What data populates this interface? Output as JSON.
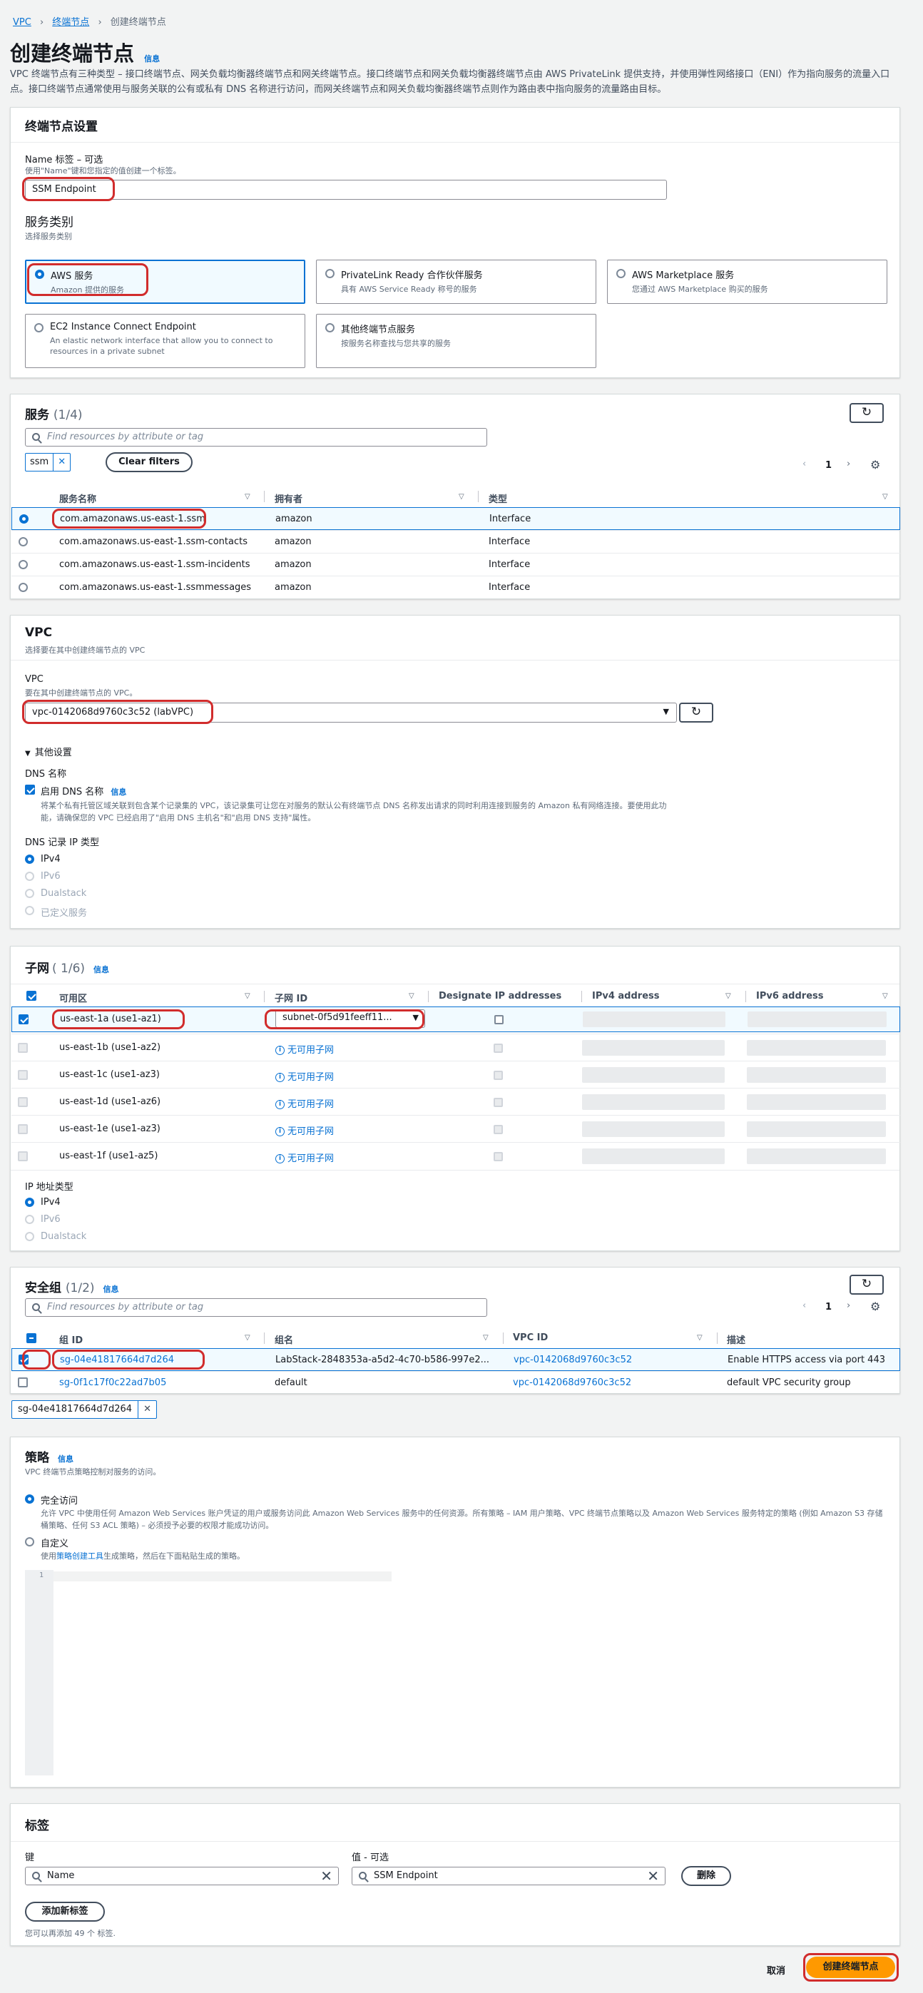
{
  "breadcrumb": {
    "items": [
      "VPC",
      "终端节点",
      "创建终端节点"
    ]
  },
  "page": {
    "title": "创建终端节点",
    "info": "信息",
    "description": "VPC 终端节点有三种类型 – 接口终端节点、网关负载均衡器终端节点和网关终端节点。接口终端节点和网关负载均衡器终端节点由 AWS PrivateLink 提供支持，并使用弹性网络接口（ENI）作为指向服务的流量入口点。接口终端节点通常使用与服务关联的公有或私有 DNS 名称进行访问，而网关终端节点和网关负载均衡器终端节点则作为路由表中指向服务的流量路由目标。"
  },
  "settings": {
    "title": "终端节点设置",
    "name_label": "Name 标签 – 可选",
    "name_hint": "使用\"Name\"键和您指定的值创建一个标签。",
    "name_value": "SSM Endpoint",
    "category_label": "服务类别",
    "category_hint": "选择服务类别",
    "tiles": [
      {
        "title": "AWS 服务",
        "desc": "Amazon 提供的服务"
      },
      {
        "title": "PrivateLink Ready 合作伙伴服务",
        "desc": "具有 AWS Service Ready 称号的服务"
      },
      {
        "title": "AWS Marketplace 服务",
        "desc": "您通过 AWS Marketplace 购买的服务"
      },
      {
        "title": "EC2 Instance Connect Endpoint",
        "desc": "An elastic network interface that allow you to connect to resources in a private subnet"
      },
      {
        "title": "其他终端节点服务",
        "desc": "按服务名称查找与您共享的服务"
      }
    ]
  },
  "services": {
    "title": "服务",
    "count": "(1/4)",
    "search_placeholder": "Find resources by attribute or tag",
    "filter_token": "ssm",
    "clear": "Clear filters",
    "page": "1",
    "columns": [
      "服务名称",
      "拥有者",
      "类型"
    ],
    "rows": [
      [
        "com.amazonaws.us-east-1.ssm",
        "amazon",
        "Interface"
      ],
      [
        "com.amazonaws.us-east-1.ssm-contacts",
        "amazon",
        "Interface"
      ],
      [
        "com.amazonaws.us-east-1.ssm-incidents",
        "amazon",
        "Interface"
      ],
      [
        "com.amazonaws.us-east-1.ssmmessages",
        "amazon",
        "Interface"
      ]
    ]
  },
  "vpc": {
    "title": "VPC",
    "hint": "选择要在其中创建终端节点的 VPC",
    "label": "VPC",
    "label_hint": "要在其中创建终端节点的 VPC。",
    "value": "vpc-0142068d9760c3c52 (labVPC)",
    "additional": "其他设置",
    "dns_label": "DNS 名称",
    "dns_check": "启用 DNS 名称",
    "dns_info": "信息",
    "dns_desc": "将某个私有托管区域关联到包含某个记录集的 VPC，该记录集可让您在对服务的默认公有终端节点 DNS 名称发出请求的同时利用连接到服务的 Amazon 私有网络连接。要使用此功能，请确保您的 VPC 已经启用了\"启用 DNS 主机名\"和\"启用 DNS 支持\"属性。",
    "ip_type_label": "DNS 记录 IP 类型",
    "ip_types": [
      "IPv4",
      "IPv6",
      "Dualstack",
      "已定义服务"
    ]
  },
  "subnets": {
    "title": "子网",
    "count": "( 1/6)",
    "info": "信息",
    "columns": [
      "可用区",
      "子网 ID",
      "Designate IP addresses",
      "IPv4 address",
      "IPv6 address"
    ],
    "rows": [
      {
        "az": "us-east-1a (use1-az1)",
        "subnet": "subnet-0f5d91feeff11..."
      },
      {
        "az": "us-east-1b (use1-az2)",
        "subnet": "无可用子网"
      },
      {
        "az": "us-east-1c (use1-az3)",
        "subnet": "无可用子网"
      },
      {
        "az": "us-east-1d (use1-az6)",
        "subnet": "无可用子网"
      },
      {
        "az": "us-east-1e (use1-az3)",
        "subnet": "无可用子网"
      },
      {
        "az": "us-east-1f (use1-az5)",
        "subnet": "无可用子网"
      }
    ],
    "ip_label": "IP 地址类型",
    "ip_types": [
      "IPv4",
      "IPv6",
      "Dualstack"
    ]
  },
  "sg": {
    "title": "安全组",
    "count": "(1/2)",
    "info": "信息",
    "search_placeholder": "Find resources by attribute or tag",
    "page": "1",
    "columns": [
      "组 ID",
      "组名",
      "VPC ID",
      "描述"
    ],
    "rows": [
      [
        "sg-04e41817664d7d264",
        "LabStack-2848353a-a5d2-4c70-b586-997e2...",
        "vpc-0142068d9760c3c52",
        "Enable HTTPS access via port 443"
      ],
      [
        "sg-0f1c17f0c22ad7b05",
        "default",
        "vpc-0142068d9760c3c52",
        "default VPC security group"
      ]
    ],
    "token": "sg-04e41817664d7d264"
  },
  "policy": {
    "title": "策略",
    "info": "信息",
    "hint": "VPC 终端节点策略控制对服务的访问。",
    "full_label": "完全访问",
    "full_desc": "允许 VPC 中使用任何 Amazon Web Services 账户凭证的用户或服务访问此 Amazon Web Services 服务中的任何资源。所有策略 – IAM 用户策略、VPC 终端节点策略以及 Amazon Web Services 服务特定的策略 (例如 Amazon S3 存储桶策略、任何 S3 ACL 策略) – 必须授予必要的权限才能成功访问。",
    "custom_label": "自定义",
    "custom_desc_prefix": "使用",
    "custom_desc_link": "策略创建工具",
    "custom_desc_suffix": "生成策略，然后在下面粘贴生成的策略。",
    "line_no": "1"
  },
  "tags": {
    "title": "标签",
    "key_label": "键",
    "value_label": "值 - 可选",
    "key": "Name",
    "value": "SSM Endpoint",
    "remove": "删除",
    "add": "添加新标签",
    "hint": "您可以再添加 49 个 标签."
  },
  "footer": {
    "cancel": "取消",
    "create": "创建终端节点"
  }
}
